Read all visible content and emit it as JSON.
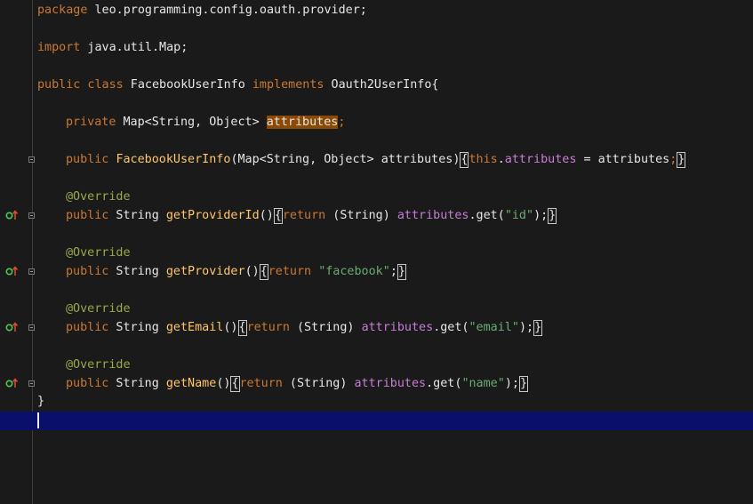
{
  "code": {
    "package_kw": "package",
    "package_name": " leo.programming.config.oauth.provider;",
    "import_kw": "import",
    "import_name": " java.util.Map;",
    "public_kw": "public",
    "class_kw": " class",
    "class_name": " FacebookUserInfo ",
    "implements_kw": "implements",
    "interface_name": " Oauth2UserInfo{",
    "private_kw": "private",
    "field_type": " Map<String, Object> ",
    "field_name": "attributes",
    "semicolon": ";",
    "ctor_name": "FacebookUserInfo",
    "ctor_params": "(Map<String, Object> attributes)",
    "open_brace": "{",
    "close_brace": "}",
    "this_kw": "this",
    "dot": ".",
    "attributes": "attributes",
    "assign": " = attributes",
    "override": "@Override",
    "string_type": " String ",
    "return_kw": "return",
    "cast": " (String) ",
    "get_open": ".get(",
    "get_close": ");",
    "empty_parens": "()",
    "methods": [
      {
        "name": "getProviderId",
        "arg": "\"id\""
      },
      {
        "name": "getProvider",
        "literal": "\"facebook\""
      },
      {
        "name": "getEmail",
        "arg": "\"email\""
      },
      {
        "name": "getName",
        "arg": "\"name\""
      }
    ],
    "class_close": "}"
  },
  "gutter": {
    "override_icon": "override-method-icon",
    "fold_icon": "fold-marker-icon"
  },
  "colors": {
    "background": "#1a1a1a",
    "keyword": "#cc7832",
    "annotation": "#9aa84a",
    "method": "#ffc66d",
    "field": "#c77dd6",
    "string": "#6aab73",
    "selection": "#8a4a05",
    "current_line": "#0a0f6b"
  }
}
